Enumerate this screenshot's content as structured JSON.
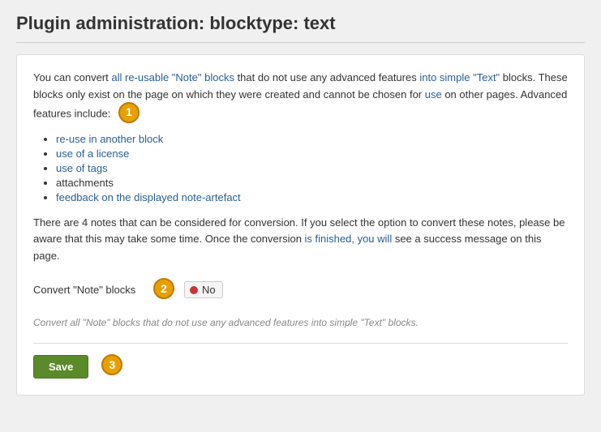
{
  "page": {
    "title": "Plugin administration: blocktype: text"
  },
  "content": {
    "description_part1": "You can convert all re-usable \"Note\" blocks that do not use any advanced features into simple \"Text\" blocks. These blocks only exist on the page on which they were created and cannot be chosen for use on other pages. Advanced features include:",
    "features": [
      "re-use in another block",
      "use of a license",
      "use of tags",
      "attachments",
      "feedback on the displayed note-artefact"
    ],
    "conversion_note": "There are 4 notes that can be considered for conversion. If you select the option to convert these notes, please be aware that this may take some time. Once the conversion is finished, you will see a success message on this page.",
    "convert_label": "Convert \"Note\" blocks",
    "toggle_value": "No",
    "helper_text": "Convert all \"Note\" blocks that do not use any advanced features into simple \"Text\" blocks.",
    "save_button_label": "Save",
    "annotations": {
      "bubble1": "1",
      "bubble2": "2",
      "bubble3": "3"
    }
  }
}
